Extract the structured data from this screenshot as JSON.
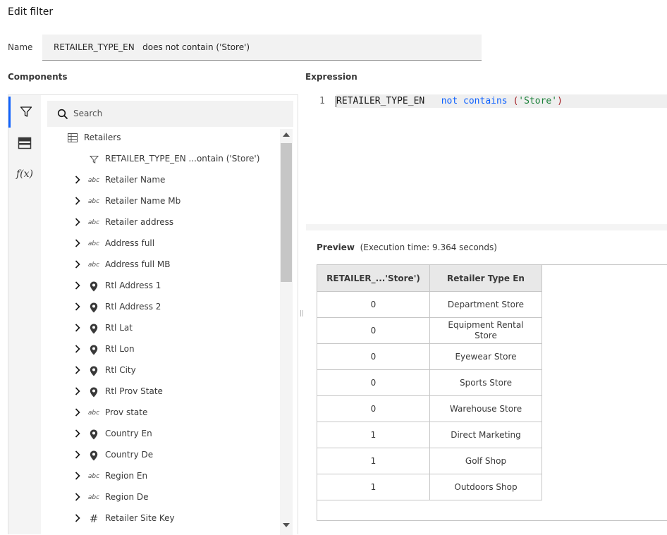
{
  "dialog": {
    "title": "Edit filter"
  },
  "name_field": {
    "label": "Name",
    "value": "RETAILER_TYPE_EN   does not contain ('Store')"
  },
  "components": {
    "label": "Components",
    "sidebar_icons": [
      "filter-icon",
      "data-item-icon",
      "function-icon"
    ],
    "sidebar_function_text": "f(x)",
    "search_placeholder": "Search",
    "tree": {
      "root": "Retailers",
      "filter_item": "RETAILER_TYPE_EN ...ontain ('Store')",
      "items": [
        {
          "label": "Retailer Name",
          "type": "abc"
        },
        {
          "label": "Retailer Name Mb",
          "type": "abc"
        },
        {
          "label": "Retailer address",
          "type": "abc"
        },
        {
          "label": "Address full",
          "type": "abc"
        },
        {
          "label": "Address full MB",
          "type": "abc"
        },
        {
          "label": "Rtl Address 1",
          "type": "geo"
        },
        {
          "label": "Rtl Address 2",
          "type": "geo"
        },
        {
          "label": "Rtl Lat",
          "type": "geo"
        },
        {
          "label": "Rtl Lon",
          "type": "geo"
        },
        {
          "label": "Rtl City",
          "type": "geo"
        },
        {
          "label": "Rtl Prov State",
          "type": "geo"
        },
        {
          "label": "Prov state",
          "type": "abc"
        },
        {
          "label": "Country En",
          "type": "geo"
        },
        {
          "label": "Country De",
          "type": "geo"
        },
        {
          "label": "Region En",
          "type": "abc"
        },
        {
          "label": "Region De",
          "type": "abc"
        },
        {
          "label": "Retailer Site Key",
          "type": "num"
        }
      ]
    },
    "type_marks": {
      "abc": "abc",
      "num": "#"
    }
  },
  "expression": {
    "label": "Expression",
    "line_number": "1",
    "field": "RETAILER_TYPE_EN",
    "operator": "not contains",
    "paren_open": "(",
    "string": "'Store'",
    "paren_close": ")"
  },
  "preview": {
    "label": "Preview",
    "execution": "(Execution time: 9.364 seconds)",
    "columns": [
      "RETAILER_...'Store')",
      "Retailer Type En"
    ],
    "rows": [
      [
        "0",
        "Department Store"
      ],
      [
        "0",
        "Equipment Rental Store"
      ],
      [
        "0",
        "Eyewear Store"
      ],
      [
        "0",
        "Sports Store"
      ],
      [
        "0",
        "Warehouse Store"
      ],
      [
        "1",
        "Direct Marketing"
      ],
      [
        "1",
        "Golf Shop"
      ],
      [
        "1",
        "Outdoors Shop"
      ]
    ]
  },
  "colors": {
    "accent": "#0f62fe",
    "keyword": "#0f62fe",
    "string": "#198038",
    "paren": "#a2191f"
  }
}
